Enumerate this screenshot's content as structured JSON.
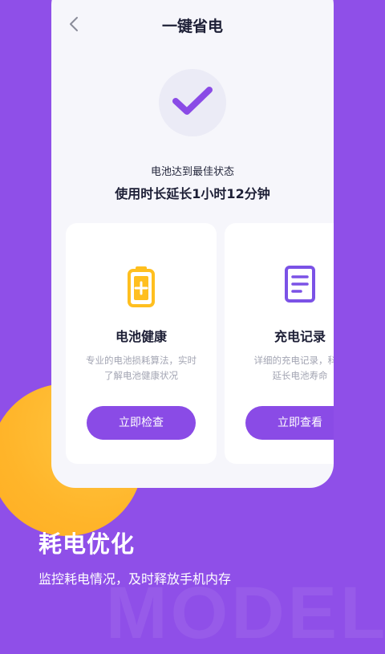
{
  "colors": {
    "background": "#8f4fe8",
    "accent_purple": "#8a4be6",
    "accent_yellow": "#ffb52a",
    "card_bg": "#ffffff",
    "screen_bg": "#f6f6fb"
  },
  "screen": {
    "title": "一键省电",
    "back_icon": "chevron-left-icon",
    "status_icon": "check-icon",
    "status_line1": "电池达到最佳状态",
    "status_line2": "使用时长延长1小时12分钟",
    "cards": [
      {
        "icon": "battery-plus-icon",
        "title": "电池健康",
        "desc_line1": "专业的电池损耗算法，实时",
        "desc_line2": "了解电池健康状况",
        "button": "立即检查"
      },
      {
        "icon": "clipboard-icon",
        "title": "充电记录",
        "desc_line1": "详细的充电记录，科学",
        "desc_line2": "延长电池寿命",
        "button": "立即查看"
      }
    ]
  },
  "promo": {
    "headline": "耗电优化",
    "subline": "监控耗电情况，及时释放手机内存",
    "watermark": "MODEL"
  }
}
